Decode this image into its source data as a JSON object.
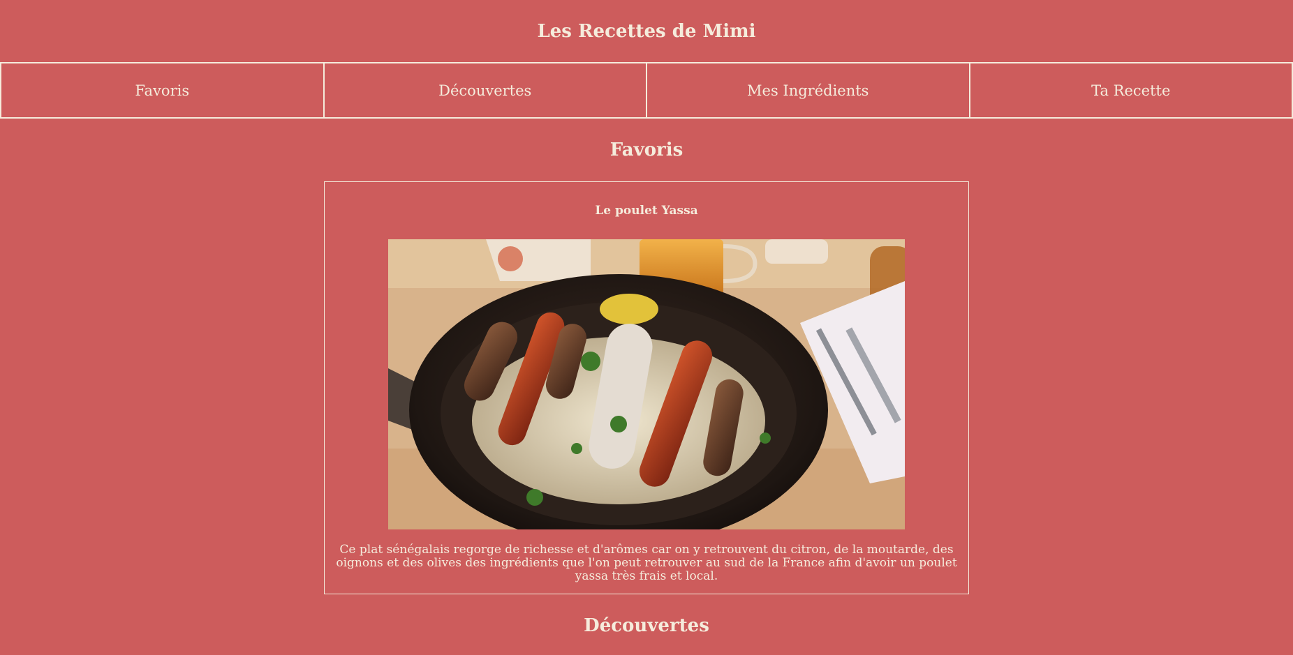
{
  "site": {
    "title": "Les Recettes de Mimi"
  },
  "nav": {
    "items": [
      {
        "label": "Favoris"
      },
      {
        "label": "Découvertes"
      },
      {
        "label": "Mes Ingrédients"
      },
      {
        "label": "Ta Recette"
      }
    ]
  },
  "favoris": {
    "title": "Favoris",
    "card": {
      "title": "Le poulet Yassa",
      "image_alt": "photo of sausages in a pan with sauerkraut",
      "description": "Ce plat sénégalais regorge de richesse et d'arômes car on y retrouvent du citron, de la moutarde, des oignons et des olives des ingrédients que l'on peut retrouver au sud de la France afin d'avoir un poulet yassa très frais et local."
    }
  },
  "decouvertes": {
    "title": "Découvertes"
  },
  "colors": {
    "background": "#cd5c5c",
    "text": "#f5ecdc"
  }
}
